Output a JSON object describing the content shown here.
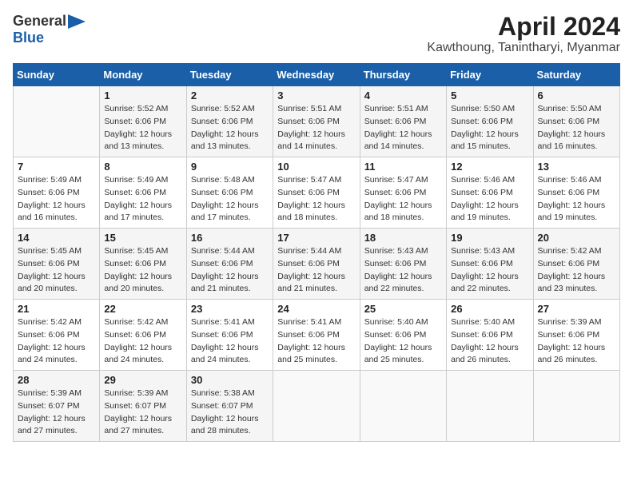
{
  "logo": {
    "general": "General",
    "blue": "Blue",
    "icon": "▶"
  },
  "title": "April 2024",
  "location": "Kawthoung, Tanintharyi, Myanmar",
  "headers": [
    "Sunday",
    "Monday",
    "Tuesday",
    "Wednesday",
    "Thursday",
    "Friday",
    "Saturday"
  ],
  "weeks": [
    [
      {
        "day": "",
        "detail": ""
      },
      {
        "day": "1",
        "detail": "Sunrise: 5:52 AM\nSunset: 6:06 PM\nDaylight: 12 hours\nand 13 minutes."
      },
      {
        "day": "2",
        "detail": "Sunrise: 5:52 AM\nSunset: 6:06 PM\nDaylight: 12 hours\nand 13 minutes."
      },
      {
        "day": "3",
        "detail": "Sunrise: 5:51 AM\nSunset: 6:06 PM\nDaylight: 12 hours\nand 14 minutes."
      },
      {
        "day": "4",
        "detail": "Sunrise: 5:51 AM\nSunset: 6:06 PM\nDaylight: 12 hours\nand 14 minutes."
      },
      {
        "day": "5",
        "detail": "Sunrise: 5:50 AM\nSunset: 6:06 PM\nDaylight: 12 hours\nand 15 minutes."
      },
      {
        "day": "6",
        "detail": "Sunrise: 5:50 AM\nSunset: 6:06 PM\nDaylight: 12 hours\nand 16 minutes."
      }
    ],
    [
      {
        "day": "7",
        "detail": "Sunrise: 5:49 AM\nSunset: 6:06 PM\nDaylight: 12 hours\nand 16 minutes."
      },
      {
        "day": "8",
        "detail": "Sunrise: 5:49 AM\nSunset: 6:06 PM\nDaylight: 12 hours\nand 17 minutes."
      },
      {
        "day": "9",
        "detail": "Sunrise: 5:48 AM\nSunset: 6:06 PM\nDaylight: 12 hours\nand 17 minutes."
      },
      {
        "day": "10",
        "detail": "Sunrise: 5:47 AM\nSunset: 6:06 PM\nDaylight: 12 hours\nand 18 minutes."
      },
      {
        "day": "11",
        "detail": "Sunrise: 5:47 AM\nSunset: 6:06 PM\nDaylight: 12 hours\nand 18 minutes."
      },
      {
        "day": "12",
        "detail": "Sunrise: 5:46 AM\nSunset: 6:06 PM\nDaylight: 12 hours\nand 19 minutes."
      },
      {
        "day": "13",
        "detail": "Sunrise: 5:46 AM\nSunset: 6:06 PM\nDaylight: 12 hours\nand 19 minutes."
      }
    ],
    [
      {
        "day": "14",
        "detail": "Sunrise: 5:45 AM\nSunset: 6:06 PM\nDaylight: 12 hours\nand 20 minutes."
      },
      {
        "day": "15",
        "detail": "Sunrise: 5:45 AM\nSunset: 6:06 PM\nDaylight: 12 hours\nand 20 minutes."
      },
      {
        "day": "16",
        "detail": "Sunrise: 5:44 AM\nSunset: 6:06 PM\nDaylight: 12 hours\nand 21 minutes."
      },
      {
        "day": "17",
        "detail": "Sunrise: 5:44 AM\nSunset: 6:06 PM\nDaylight: 12 hours\nand 21 minutes."
      },
      {
        "day": "18",
        "detail": "Sunrise: 5:43 AM\nSunset: 6:06 PM\nDaylight: 12 hours\nand 22 minutes."
      },
      {
        "day": "19",
        "detail": "Sunrise: 5:43 AM\nSunset: 6:06 PM\nDaylight: 12 hours\nand 22 minutes."
      },
      {
        "day": "20",
        "detail": "Sunrise: 5:42 AM\nSunset: 6:06 PM\nDaylight: 12 hours\nand 23 minutes."
      }
    ],
    [
      {
        "day": "21",
        "detail": "Sunrise: 5:42 AM\nSunset: 6:06 PM\nDaylight: 12 hours\nand 24 minutes."
      },
      {
        "day": "22",
        "detail": "Sunrise: 5:42 AM\nSunset: 6:06 PM\nDaylight: 12 hours\nand 24 minutes."
      },
      {
        "day": "23",
        "detail": "Sunrise: 5:41 AM\nSunset: 6:06 PM\nDaylight: 12 hours\nand 24 minutes."
      },
      {
        "day": "24",
        "detail": "Sunrise: 5:41 AM\nSunset: 6:06 PM\nDaylight: 12 hours\nand 25 minutes."
      },
      {
        "day": "25",
        "detail": "Sunrise: 5:40 AM\nSunset: 6:06 PM\nDaylight: 12 hours\nand 25 minutes."
      },
      {
        "day": "26",
        "detail": "Sunrise: 5:40 AM\nSunset: 6:06 PM\nDaylight: 12 hours\nand 26 minutes."
      },
      {
        "day": "27",
        "detail": "Sunrise: 5:39 AM\nSunset: 6:06 PM\nDaylight: 12 hours\nand 26 minutes."
      }
    ],
    [
      {
        "day": "28",
        "detail": "Sunrise: 5:39 AM\nSunset: 6:07 PM\nDaylight: 12 hours\nand 27 minutes."
      },
      {
        "day": "29",
        "detail": "Sunrise: 5:39 AM\nSunset: 6:07 PM\nDaylight: 12 hours\nand 27 minutes."
      },
      {
        "day": "30",
        "detail": "Sunrise: 5:38 AM\nSunset: 6:07 PM\nDaylight: 12 hours\nand 28 minutes."
      },
      {
        "day": "",
        "detail": ""
      },
      {
        "day": "",
        "detail": ""
      },
      {
        "day": "",
        "detail": ""
      },
      {
        "day": "",
        "detail": ""
      }
    ]
  ]
}
